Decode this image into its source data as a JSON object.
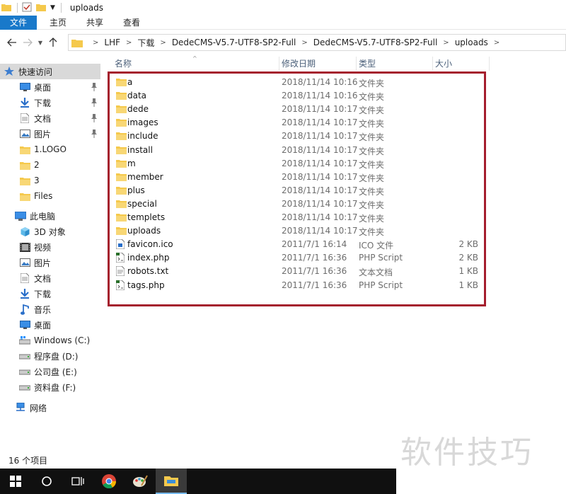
{
  "window": {
    "title": "uploads"
  },
  "ribbon": {
    "tabs": [
      "文件",
      "主页",
      "共享",
      "查看"
    ]
  },
  "address": {
    "crumbs": [
      "LHF",
      "下载",
      "DedeCMS-V5.7-UTF8-SP2-Full",
      "DedeCMS-V5.7-UTF8-SP2-Full",
      "uploads"
    ]
  },
  "sidebar": {
    "items": [
      {
        "label": "快速访问",
        "icon": "star-icon",
        "pinned": false
      },
      {
        "label": "桌面",
        "icon": "desktop-icon",
        "pinned": true
      },
      {
        "label": "下载",
        "icon": "download-icon",
        "pinned": true
      },
      {
        "label": "文档",
        "icon": "document-icon",
        "pinned": true
      },
      {
        "label": "图片",
        "icon": "pictures-icon",
        "pinned": true
      },
      {
        "label": "1.LOGO",
        "icon": "folder-icon",
        "pinned": false
      },
      {
        "label": "2",
        "icon": "folder-icon",
        "pinned": false
      },
      {
        "label": "3",
        "icon": "folder-icon",
        "pinned": false
      },
      {
        "label": "Files",
        "icon": "folder-icon",
        "pinned": false
      },
      {
        "label": "此电脑",
        "icon": "computer-icon",
        "pinned": false
      },
      {
        "label": "3D 对象",
        "icon": "3d-objects-icon",
        "pinned": false
      },
      {
        "label": "视频",
        "icon": "video-icon",
        "pinned": false
      },
      {
        "label": "图片",
        "icon": "pictures-icon",
        "pinned": false
      },
      {
        "label": "文档",
        "icon": "document-icon",
        "pinned": false
      },
      {
        "label": "下载",
        "icon": "download-icon",
        "pinned": false
      },
      {
        "label": "音乐",
        "icon": "music-icon",
        "pinned": false
      },
      {
        "label": "桌面",
        "icon": "desktop-icon",
        "pinned": false
      },
      {
        "label": "Windows (C:)",
        "icon": "windows-drive-icon",
        "pinned": false
      },
      {
        "label": "程序盘 (D:)",
        "icon": "drive-icon",
        "pinned": false
      },
      {
        "label": "公司盘 (E:)",
        "icon": "drive-icon",
        "pinned": false
      },
      {
        "label": "资料盘 (F:)",
        "icon": "drive-icon",
        "pinned": false
      },
      {
        "label": "网络",
        "icon": "network-icon",
        "pinned": false
      }
    ]
  },
  "columns": {
    "name": "名称",
    "date": "修改日期",
    "type": "类型",
    "size": "大小"
  },
  "files": [
    {
      "name": "a",
      "date": "2018/11/14 10:16",
      "type": "文件夹",
      "size": "",
      "icon": "folder-icon"
    },
    {
      "name": "data",
      "date": "2018/11/14 10:16",
      "type": "文件夹",
      "size": "",
      "icon": "folder-icon"
    },
    {
      "name": "dede",
      "date": "2018/11/14 10:17",
      "type": "文件夹",
      "size": "",
      "icon": "folder-icon"
    },
    {
      "name": "images",
      "date": "2018/11/14 10:17",
      "type": "文件夹",
      "size": "",
      "icon": "folder-icon"
    },
    {
      "name": "include",
      "date": "2018/11/14 10:17",
      "type": "文件夹",
      "size": "",
      "icon": "folder-icon"
    },
    {
      "name": "install",
      "date": "2018/11/14 10:17",
      "type": "文件夹",
      "size": "",
      "icon": "folder-icon"
    },
    {
      "name": "m",
      "date": "2018/11/14 10:17",
      "type": "文件夹",
      "size": "",
      "icon": "folder-icon"
    },
    {
      "name": "member",
      "date": "2018/11/14 10:17",
      "type": "文件夹",
      "size": "",
      "icon": "folder-icon"
    },
    {
      "name": "plus",
      "date": "2018/11/14 10:17",
      "type": "文件夹",
      "size": "",
      "icon": "folder-icon"
    },
    {
      "name": "special",
      "date": "2018/11/14 10:17",
      "type": "文件夹",
      "size": "",
      "icon": "folder-icon"
    },
    {
      "name": "templets",
      "date": "2018/11/14 10:17",
      "type": "文件夹",
      "size": "",
      "icon": "folder-icon"
    },
    {
      "name": "uploads",
      "date": "2018/11/14 10:17",
      "type": "文件夹",
      "size": "",
      "icon": "folder-icon"
    },
    {
      "name": "favicon.ico",
      "date": "2011/7/1 16:14",
      "type": "ICO 文件",
      "size": "2 KB",
      "icon": "ico-file-icon"
    },
    {
      "name": "index.php",
      "date": "2011/7/1 16:36",
      "type": "PHP Script",
      "size": "2 KB",
      "icon": "php-file-icon"
    },
    {
      "name": "robots.txt",
      "date": "2011/7/1 16:36",
      "type": "文本文档",
      "size": "1 KB",
      "icon": "text-file-icon"
    },
    {
      "name": "tags.php",
      "date": "2011/7/1 16:36",
      "type": "PHP Script",
      "size": "1 KB",
      "icon": "php-file-icon"
    }
  ],
  "status": {
    "text": "16 个项目"
  },
  "taskbar": {
    "buttons": [
      "windows-start-icon",
      "search-circle-icon",
      "task-view-icon",
      "chrome-icon",
      "paint-icon",
      "file-explorer-icon"
    ]
  },
  "watermark": {
    "text": "软件技巧"
  },
  "colors": {
    "accent": "#1979ca",
    "highlight": "#a51d2d",
    "folder": "#f5c94c"
  }
}
